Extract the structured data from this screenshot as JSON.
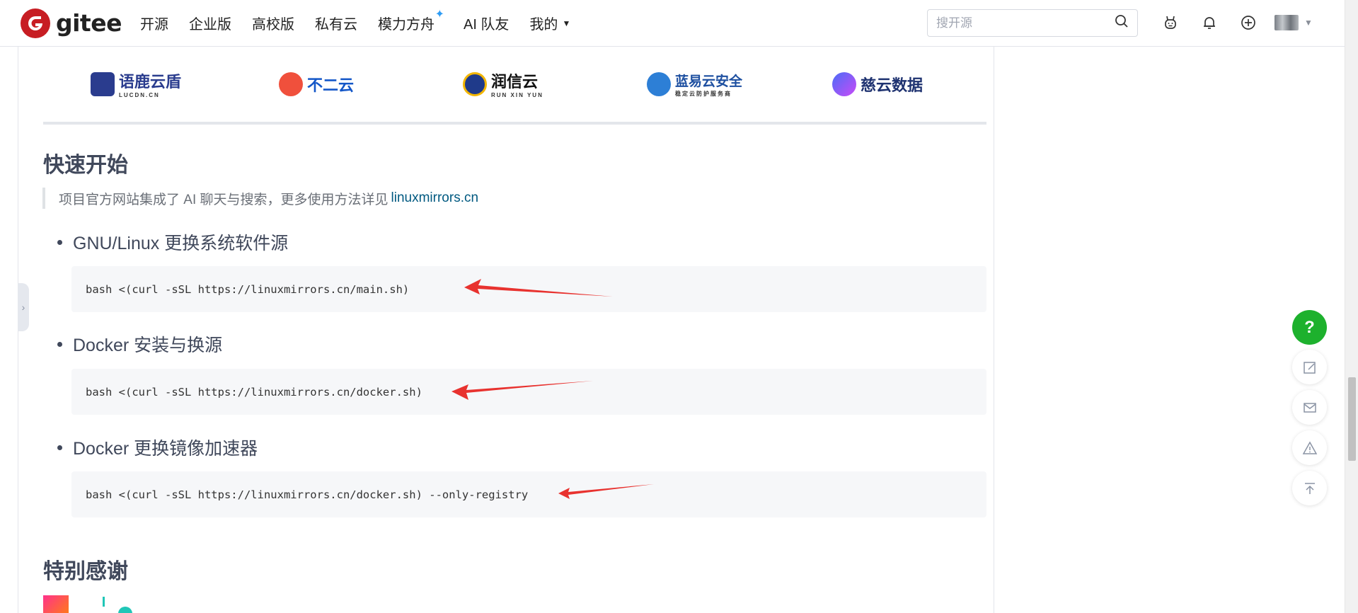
{
  "nav": {
    "logo_text": "gitee",
    "items": [
      "开源",
      "企业版",
      "高校版",
      "私有云",
      "模力方舟",
      "AI 队友",
      "我的"
    ],
    "search_placeholder": "搜开源"
  },
  "sponsors": [
    "语鹿云盾",
    "LUCDN.CN",
    "不二云",
    "润信云",
    "RUN XIN YUN",
    "蓝易云安全",
    "稳定云防护服务商",
    "慈云数据"
  ],
  "section_quick": {
    "title": "快速开始",
    "quote_text": "项目官方网站集成了 AI 聊天与搜索，更多使用方法详见",
    "quote_link": "linuxmirrors.cn",
    "items": [
      {
        "label": "GNU/Linux 更换系统软件源",
        "code": "bash <(curl -sSL https://linuxmirrors.cn/main.sh)"
      },
      {
        "label": "Docker 安装与换源",
        "code": "bash <(curl -sSL https://linuxmirrors.cn/docker.sh)"
      },
      {
        "label": "Docker 更换镜像加速器",
        "code": "bash <(curl -sSL https://linuxmirrors.cn/docker.sh) --only-registry"
      }
    ]
  },
  "section_thanks": {
    "title": "特别感谢"
  },
  "colors": {
    "brand": "#c71d23",
    "help_button": "#1db12d",
    "link": "#005980",
    "arrow": "#e8322f"
  },
  "icons": {
    "search": "search-icon",
    "ai": "robot-icon",
    "bell": "bell-icon",
    "plus": "plus-circle-icon",
    "help": "question-icon",
    "edit": "edit-icon",
    "mail": "mail-icon",
    "warn": "warning-icon",
    "top": "back-to-top-icon"
  },
  "help_label": "?"
}
